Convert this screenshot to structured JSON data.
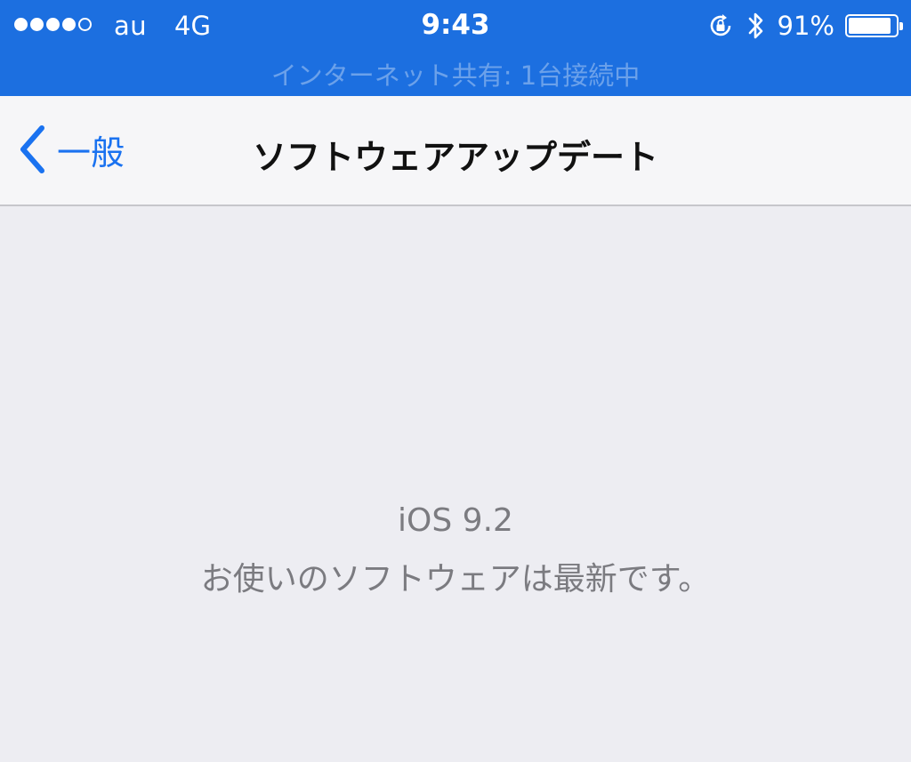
{
  "status_bar": {
    "signal_bars_filled": 4,
    "signal_bars_total": 5,
    "carrier": "au",
    "network": "4G",
    "time": "9:43",
    "orientation_lock_icon": "orientation-lock-icon",
    "bluetooth_icon": "bluetooth-icon",
    "battery_percent": "91%",
    "battery_level": 0.91,
    "hotspot_message": "インターネット共有: 1台接続中"
  },
  "nav": {
    "back_label": "一般",
    "title": "ソフトウェアアップデート"
  },
  "content": {
    "version": "iOS 9.2",
    "message": "お使いのソフトウェアは最新です。"
  },
  "colors": {
    "status_bar_bg": "#1c6fe0",
    "nav_bar_bg": "#f6f6f8",
    "background": "#ededf2",
    "accent": "#1a72f0",
    "secondary_text": "#7b7b80"
  }
}
